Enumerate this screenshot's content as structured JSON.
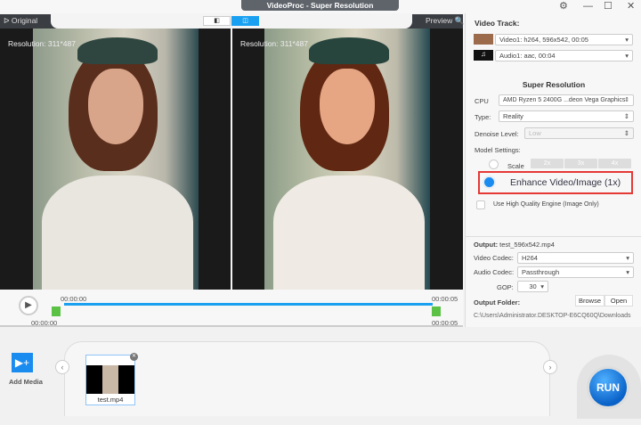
{
  "app": {
    "title": "VideoProc  -  Super Resolution"
  },
  "preview": {
    "original_label": "ᐅ Original",
    "preview_label": "Preview 🔍",
    "left_resolution": "Resolution: 311*487",
    "right_resolution": "Resolution: 311*487"
  },
  "timeline": {
    "start_top": "00:00:00",
    "start_bottom": "00:00:00",
    "end_top": "00:00:05",
    "end_bottom": "00:00:05",
    "progress": 1.0
  },
  "panel": {
    "video_track_title": "Video Track:",
    "video_track": "Video1: h264, 596x542, 00:05",
    "audio_track": "Audio1: aac, 00:04",
    "section_title": "Super Resolution",
    "cpu_label": "CPU",
    "cpu_value": "AMD Ryzen 5 2400G ...deon Vega Graphics",
    "type_label": "Type:",
    "type_value": "Reality",
    "denoise_label": "Denoise Level:",
    "denoise_value": "Low",
    "model_label": "Model Settings:",
    "scale_label": "Scale",
    "scale_options": [
      "2x",
      "3x",
      "4x"
    ],
    "enhance_label": "Enhance Video/Image (1x)",
    "hq_label": "Use High Quality Engine (Image Only)",
    "output_label": "Output:",
    "output_value": "test_596x542.mp4",
    "vcodec_label": "Video Codec:",
    "vcodec_value": "H264",
    "acodec_label": "Audio Codec:",
    "acodec_value": "Passthrough",
    "gop_label": "GOP:",
    "gop_value": "30",
    "folder_label": "Output Folder:",
    "browse": "Browse",
    "open": "Open",
    "folder_path": "C:\\Users\\Administrator.DESKTOP-E6CQ60Q\\Downloads"
  },
  "bottom": {
    "add_media": "Add Media",
    "file_name": "test.mp4",
    "run": "RUN"
  },
  "colors": {
    "accent": "#1aa0f0",
    "highlight": "#e53935",
    "marker": "#5bc245"
  }
}
